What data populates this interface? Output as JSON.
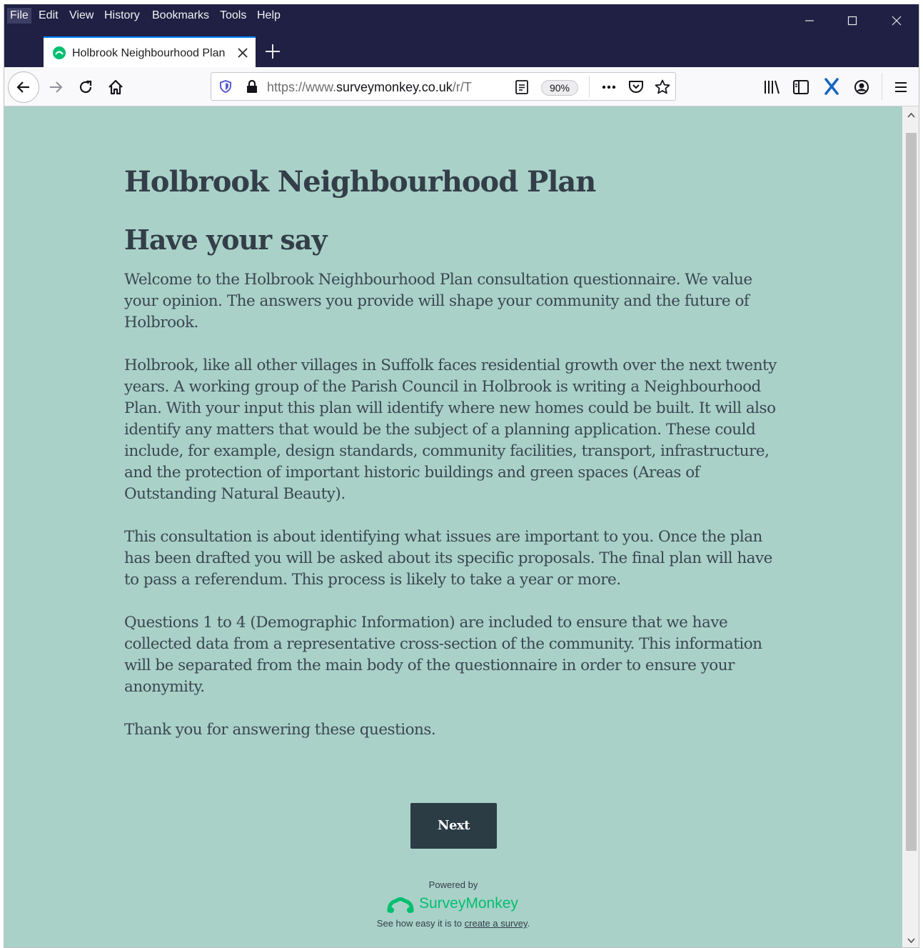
{
  "menubar": {
    "items": [
      "File",
      "Edit",
      "View",
      "History",
      "Bookmarks",
      "Tools",
      "Help"
    ]
  },
  "tab": {
    "title": "Holbrook Neighbourhood Plan",
    "favicon": "surveymonkey-favicon"
  },
  "navbar": {
    "url_prefix": "https://www.",
    "url_domain": "surveymonkey.co.uk",
    "url_path": "/r/T",
    "zoom": "90%"
  },
  "survey": {
    "title": "Holbrook Neighbourhood Plan",
    "page_title": "Have your say",
    "paragraphs": [
      "Welcome to the Holbrook Neighbourhood Plan consultation questionnaire. We value your opinion. The answers you provide will shape your community and the future of Holbrook.",
      "Holbrook, like all other villages in Suffolk faces residential growth over the next twenty years. A working group of the Parish Council in Holbrook is writing a Neighbourhood Plan. With your input this plan will identify where new homes could be built. It will also identify any matters that would be the subject of a planning application. These could include, for example, design standards, community facilities, transport, infrastructure, and the protection of important historic buildings and green spaces (Areas of Outstanding Natural Beauty).",
      "This consultation is about identifying what issues are important to you. Once the plan has been drafted you will be asked about its specific proposals. The final plan will have to pass a referendum. This process is likely to take a year or more.",
      "Questions 1 to 4 (Demographic Information) are included to ensure that we have collected data from a representative cross-section of the community. This information will be separated from the main body of the questionnaire in order to ensure your anonymity.",
      "Thank you for answering these questions."
    ],
    "next_label": "Next"
  },
  "footer": {
    "powered_by": "Powered by",
    "brand": "SurveyMonkey",
    "tagline_prefix": "See how easy it is to ",
    "tagline_link": "create a survey",
    "tagline_suffix": "."
  },
  "colors": {
    "content_bg": "#a9d1c8",
    "titlebar_bg": "#1f2044",
    "button_bg": "#2b3c45",
    "brand_green": "#00bf6f"
  }
}
